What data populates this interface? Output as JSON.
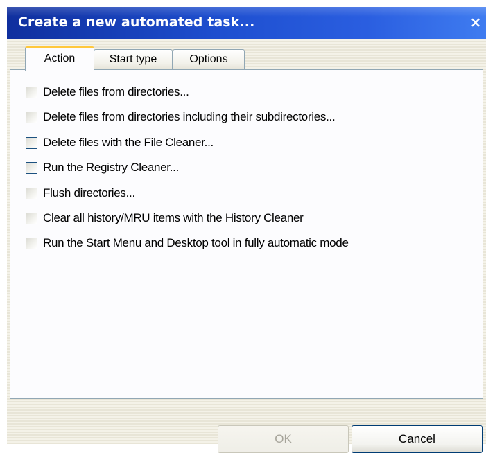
{
  "window": {
    "title": "Create a new automated task...",
    "close_glyph": "×"
  },
  "tabs": [
    {
      "label": "Action",
      "active": true
    },
    {
      "label": "Start type",
      "active": false
    },
    {
      "label": "Options",
      "active": false
    }
  ],
  "actions": [
    {
      "label": "Delete files from directories...",
      "checked": false
    },
    {
      "label": "Delete files from directories including their subdirectories...",
      "checked": false
    },
    {
      "label": "Delete files with the File Cleaner...",
      "checked": false
    },
    {
      "label": "Run the Registry Cleaner...",
      "checked": false
    },
    {
      "label": "Flush directories...",
      "checked": false
    },
    {
      "label": "Clear all history/MRU items with the History Cleaner",
      "checked": false
    },
    {
      "label": "Run the Start Menu and Desktop tool in fully automatic mode",
      "checked": false
    }
  ],
  "buttons": {
    "ok_label": "OK",
    "ok_enabled": false,
    "cancel_label": "Cancel"
  }
}
